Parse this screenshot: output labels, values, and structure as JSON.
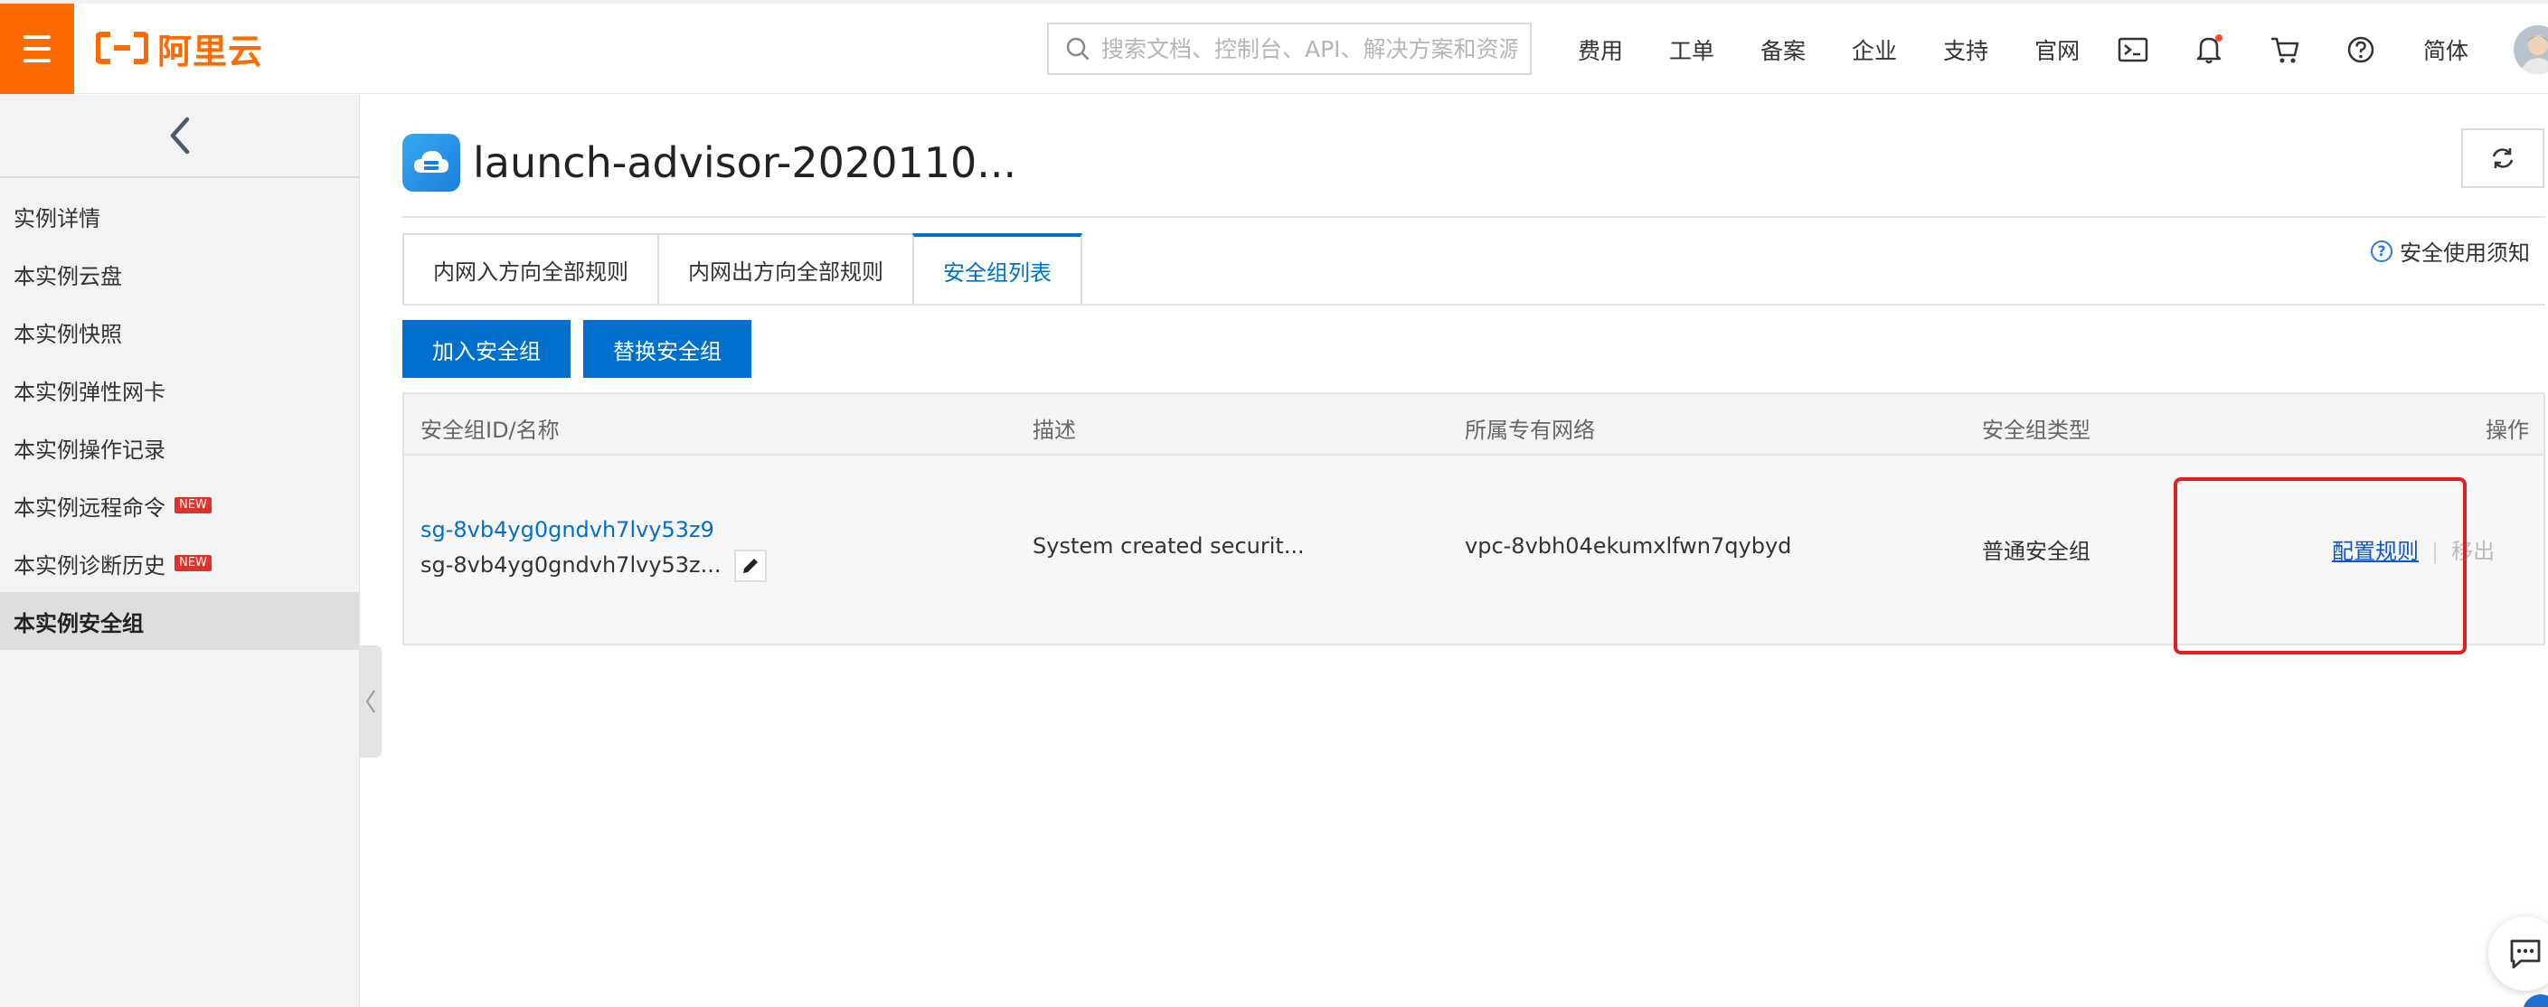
{
  "brand": {
    "logo_text": "阿里云",
    "accent": "#ff6a00"
  },
  "search": {
    "placeholder": "搜索文档、控制台、API、解决方案和资源"
  },
  "topnav": {
    "items": [
      "费用",
      "工单",
      "备案",
      "企业",
      "支持",
      "官网"
    ],
    "icons": [
      "terminal-icon",
      "bell-icon",
      "cart-icon",
      "help-icon"
    ],
    "lang": "简体"
  },
  "sidebar": {
    "items": [
      {
        "label": "实例详情",
        "badge": ""
      },
      {
        "label": "本实例云盘",
        "badge": ""
      },
      {
        "label": "本实例快照",
        "badge": ""
      },
      {
        "label": "本实例弹性网卡",
        "badge": ""
      },
      {
        "label": "本实例操作记录",
        "badge": ""
      },
      {
        "label": "本实例远程命令",
        "badge": "NEW"
      },
      {
        "label": "本实例诊断历史",
        "badge": "NEW"
      },
      {
        "label": "本实例安全组",
        "badge": ""
      }
    ],
    "active_index": 7
  },
  "page": {
    "title": "launch-advisor-2020110...",
    "help_link": "安全使用须知"
  },
  "tabs": [
    {
      "label": "内网入方向全部规则"
    },
    {
      "label": "内网出方向全部规则"
    },
    {
      "label": "安全组列表"
    }
  ],
  "buttons": {
    "join": "加入安全组",
    "replace": "替换安全组"
  },
  "table": {
    "headers": [
      "安全组ID/名称",
      "描述",
      "所属专有网络",
      "安全组类型",
      "操作"
    ],
    "rows": [
      {
        "id": "sg-8vb4yg0gndvh7lvy53z9",
        "name": "sg-8vb4yg0gndvh7lvy53z...",
        "description": "System created securit...",
        "vpc": "vpc-8vbh04ekumxlfwn7qybyd",
        "type": "普通安全组",
        "op_config": "配置规则",
        "op_sep": "|",
        "op_remove": "移出"
      }
    ]
  }
}
